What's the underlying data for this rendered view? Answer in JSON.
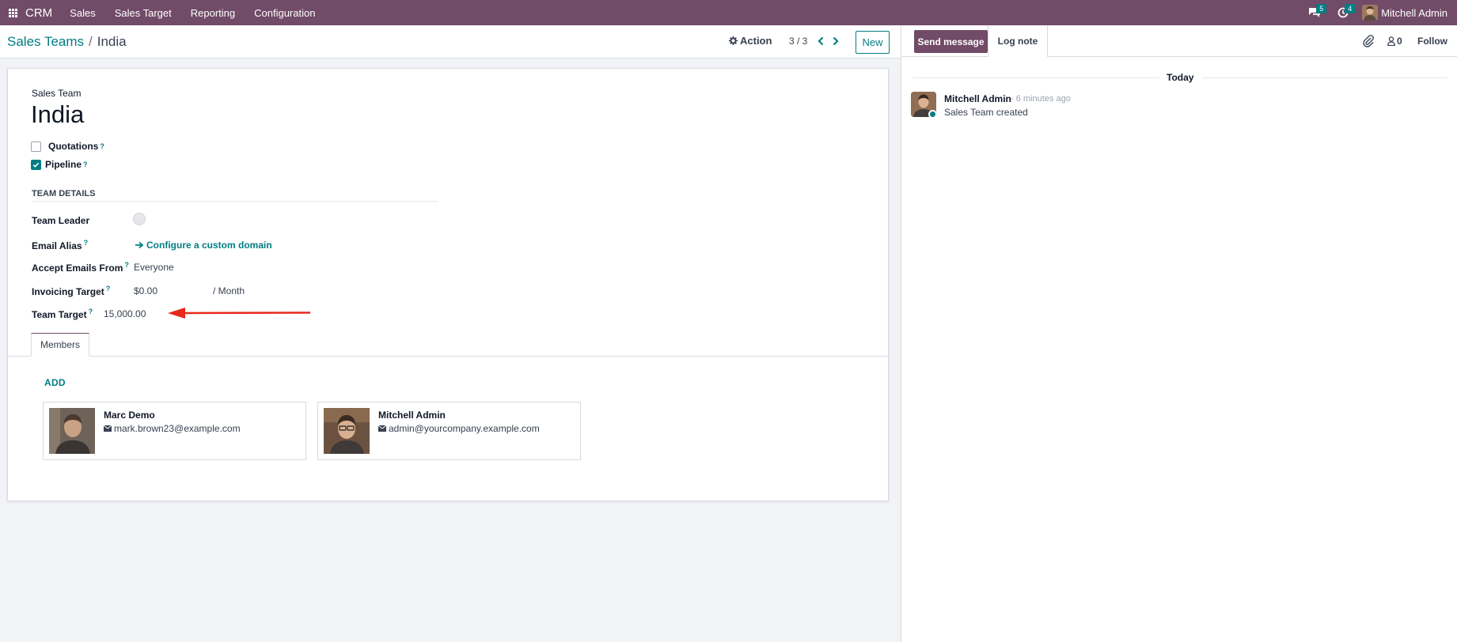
{
  "navbar": {
    "brand": "CRM",
    "menu": [
      "Sales",
      "Sales Target",
      "Reporting",
      "Configuration"
    ],
    "messages_count": "5",
    "activities_count": "4",
    "user_name": "Mitchell Admin"
  },
  "control_panel": {
    "breadcrumb_parent": "Sales Teams",
    "breadcrumb_separator": "/",
    "breadcrumb_current": "India",
    "action_label": "Action",
    "pager_value": "3 / 3",
    "new_label": "New"
  },
  "form": {
    "title_label": "Sales Team",
    "title": "India",
    "quotations_label": "Quotations",
    "quotations_checked": false,
    "pipeline_label": "Pipeline",
    "pipeline_checked": true,
    "help_mark": "?",
    "section_title": "TEAM DETAILS",
    "fields": {
      "team_leader_label": "Team Leader",
      "email_alias_label": "Email Alias",
      "email_alias_link": "Configure a custom domain",
      "accept_emails_label": "Accept Emails From",
      "accept_emails_value": "Everyone",
      "invoicing_target_label": "Invoicing Target",
      "invoicing_target_value": "$0.00",
      "invoicing_target_period": "/ Month",
      "team_target_label": "Team Target",
      "team_target_value": "15,000.00"
    },
    "tabs": [
      "Members"
    ],
    "add_label": "ADD",
    "members": [
      {
        "name": "Marc Demo",
        "email": "mark.brown23@example.com"
      },
      {
        "name": "Mitchell Admin",
        "email": "admin@yourcompany.example.com"
      }
    ]
  },
  "annotation": {
    "color": "#e8291c"
  },
  "chatter": {
    "send_message_label": "Send message",
    "log_note_label": "Log note",
    "followers_count": "0",
    "follow_label": "Follow",
    "date_separator": "Today",
    "messages": [
      {
        "author": "Mitchell Admin",
        "time": "- 6 minutes ago",
        "body": "Sales Team created"
      }
    ]
  },
  "colors": {
    "primary": "#714b67",
    "accent": "#017e84",
    "background": "#f2f3f7"
  }
}
